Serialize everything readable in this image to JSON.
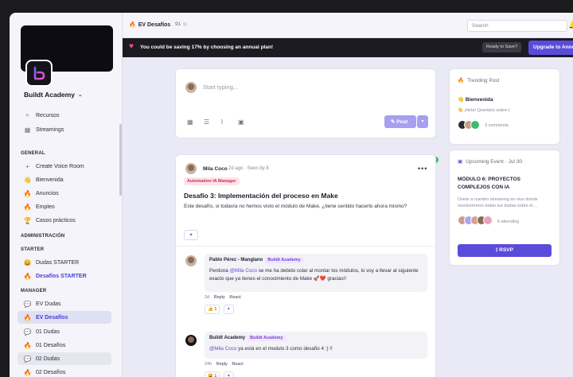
{
  "sidebar": {
    "brand": "Buildt Academy",
    "top_items": [
      {
        "label": "Recursos",
        "icon": "paperclip-icon"
      },
      {
        "label": "Streamings",
        "icon": "calendar-icon"
      }
    ],
    "general_header": "GENERAL",
    "general_items": [
      {
        "label": "Create Voice Room",
        "icon": "plus-icon"
      },
      {
        "label": "Bienvenida",
        "icon": "hand-icon"
      },
      {
        "label": "Anuncios",
        "icon": "fire-icon"
      },
      {
        "label": "Empleo",
        "icon": "flame-icon"
      },
      {
        "label": "Casos prácticos",
        "icon": "trophy-icon"
      }
    ],
    "admin_header": "ADMINISTRACIÓN",
    "starter_header": "STARTER",
    "starter_items": [
      {
        "label": "Dudas STARTER",
        "icon": "smile-icon"
      },
      {
        "label": "Desafíos STARTER",
        "icon": "fire-icon"
      }
    ],
    "manager_header": "MANAGER",
    "manager_items": [
      {
        "label": "EV Dudas",
        "icon": "chat-icon"
      },
      {
        "label": "EV Desafíos",
        "icon": "fire-icon"
      },
      {
        "label": "01 Dudas",
        "icon": "chat-icon"
      },
      {
        "label": "01 Desafíos",
        "icon": "fire-icon"
      },
      {
        "label": "02 Dudas",
        "icon": "chat-icon"
      },
      {
        "label": "02 Desafíos",
        "icon": "fire-icon"
      }
    ]
  },
  "header": {
    "breadcrumb": "EV Desafíos",
    "members": "91",
    "search_placeholder": "Search"
  },
  "promo": {
    "text": "You could be saving 17% by choosing an annual plan!",
    "ready_label": "Ready to Save?",
    "upgrade_label": "Upgrade to Annual"
  },
  "composer": {
    "placeholder": "Start typing...",
    "post_label": "Post"
  },
  "post": {
    "author": "Mila Coco",
    "meta": "2d ago · Seen by 8",
    "tag": "Automation IA Manager",
    "title": "Desafío 3: Implementación del proceso en Make",
    "body": "Este desafío, si todavía no hemos visto el módulo de Make, ¿tiene sentido hacerlo ahora mismo?",
    "reaction_count": ""
  },
  "comments": [
    {
      "author": "Pablo Pérez - Manglano",
      "badge": "Buildt Academy",
      "mention": "@Mila Coco",
      "body": "Perdona @Mila Coco se me ha debido colar al montar los módulos, lo voy a llevar al siguiente exacto que ya tienes el conocimiento de Make 🚀❤️ gracias!!",
      "body_pre": "Perdona ",
      "body_post": " se me ha debido colar al montar los módulos, lo voy a llevar al siguiente exacto que ya tienes el conocimiento de Make 🚀❤️ gracias!!",
      "time": "2d",
      "reply": "Reply",
      "react": "React",
      "emoji": "👍",
      "emoji_count": "1"
    },
    {
      "author": "Buildt Academy",
      "badge": "Buildt Academy",
      "mention": "@Mila Coco",
      "body_pre": "",
      "body_post": " ya está en el modulo 3 como desafio 4 :) !!",
      "time": "24h",
      "reply": "Reply",
      "react": "React",
      "emoji": "😀",
      "emoji_count": "1"
    }
  ],
  "trending": {
    "heading": "Trending Post",
    "title": "👋 Bienvenida",
    "excerpt": "👋 ¡Hola! Queridos sobre l.",
    "comments": "3 comments"
  },
  "upcoming": {
    "heading": "Upcoming Event · Jul 30",
    "title": "MÓDULO 6: PROYECTOS COMPLEJOS CON IA",
    "desc": "Únete a nuestro streaming en vivo donde resolveremos todas tus dudas sobre el...",
    "attending": "6 attending",
    "rsvp": "RSVP"
  },
  "colors": {
    "accent": "#5b4bdb",
    "promo_bg": "#1c1b22",
    "tag_text": "#d02a52"
  }
}
